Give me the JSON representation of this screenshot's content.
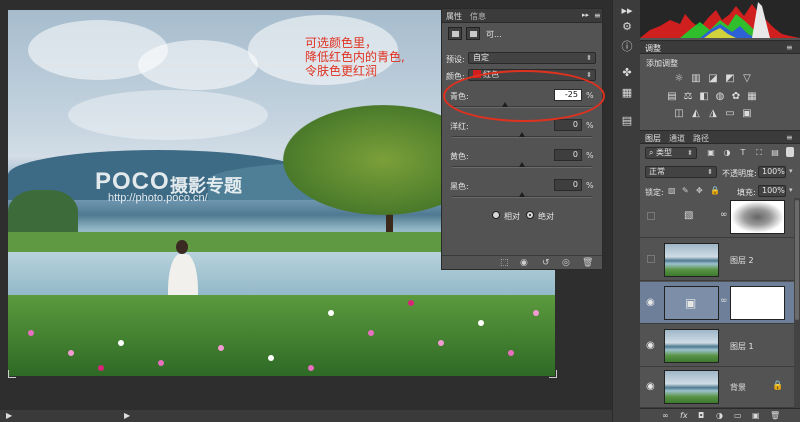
{
  "canvas": {
    "annotation_lines": [
      "可选颜色里，",
      "降低红色内的青色,",
      "令肤色更红润"
    ],
    "watermark_logo": "POCO",
    "watermark_cn": "摄影专题",
    "watermark_url": "http://photo.poco.cn/"
  },
  "properties_panel": {
    "tabs": [
      "属性",
      "信息"
    ],
    "header_label": "可...",
    "preset_label": "预设:",
    "preset_value": "自定",
    "colors_label": "颜色:",
    "colors_value": "红色",
    "colors_swatch": "#d11f1f",
    "sliders": [
      {
        "label": "青色:",
        "value": "-25",
        "unit": "%",
        "level": -25
      },
      {
        "label": "洋红:",
        "value": "0",
        "unit": "%",
        "level": 0
      },
      {
        "label": "黄色:",
        "value": "0",
        "unit": "%",
        "level": 0
      },
      {
        "label": "黑色:",
        "value": "0",
        "unit": "%",
        "level": 0
      }
    ],
    "method_relative": "相对",
    "method_absolute": "绝对",
    "method_selected": "绝对"
  },
  "adjustments_panel": {
    "tab": "调整",
    "add_label": "添加调整"
  },
  "layers_panel": {
    "tabs": [
      "图层",
      "通道",
      "路径"
    ],
    "filter_kind": "类型",
    "blend_mode": "正常",
    "opacity_label": "不透明度:",
    "opacity_value": "100%",
    "lock_label": "锁定:",
    "fill_label": "填充:",
    "fill_value": "100%",
    "layers": [
      {
        "name": "",
        "visible": false,
        "selected": false,
        "kind": "adjustment-mask"
      },
      {
        "name": "图层 2",
        "visible": false,
        "selected": false,
        "kind": "photo"
      },
      {
        "name": "",
        "visible": true,
        "selected": true,
        "kind": "selective-color"
      },
      {
        "name": "图层 1",
        "visible": true,
        "selected": false,
        "kind": "photo"
      },
      {
        "name": "背景",
        "visible": true,
        "selected": false,
        "kind": "background"
      }
    ]
  },
  "colors": {
    "annotation": "#e0311f",
    "selected_layer": "#6d7f99"
  }
}
